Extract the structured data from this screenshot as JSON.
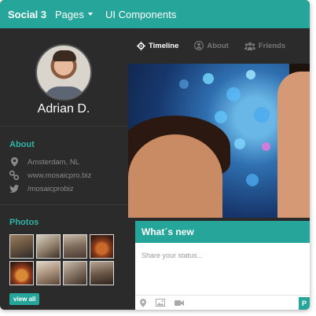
{
  "topbar": {
    "brand": "Social 3",
    "pages_label": "Pages",
    "ui_label": "UI Components"
  },
  "profile": {
    "name": "Adrian D."
  },
  "about": {
    "title": "About",
    "items": [
      {
        "icon": "map-marker-icon",
        "text": "Amsterdam, NL"
      },
      {
        "icon": "link-icon",
        "text": "www.mosaicpro.biz"
      },
      {
        "icon": "twitter-icon",
        "text": "/mosaicprobiz"
      }
    ]
  },
  "photos": {
    "title": "Photos",
    "count": 8,
    "view_all_label": "view all"
  },
  "tabs": [
    {
      "label": "Timeline",
      "icon": "gear-icon",
      "active": true
    },
    {
      "label": "About",
      "icon": "user-icon",
      "active": false
    },
    {
      "label": "Friends",
      "icon": "group-icon",
      "active": false
    }
  ],
  "whats_new": {
    "title": "What´s new",
    "placeholder": "Share your status...",
    "tools": [
      "map-marker-icon",
      "image-icon",
      "video-icon"
    ],
    "post_label": "P"
  },
  "colors": {
    "accent": "#26a69a",
    "sidebar": "#2b2b2b",
    "section_title": "#2fb3a5"
  }
}
